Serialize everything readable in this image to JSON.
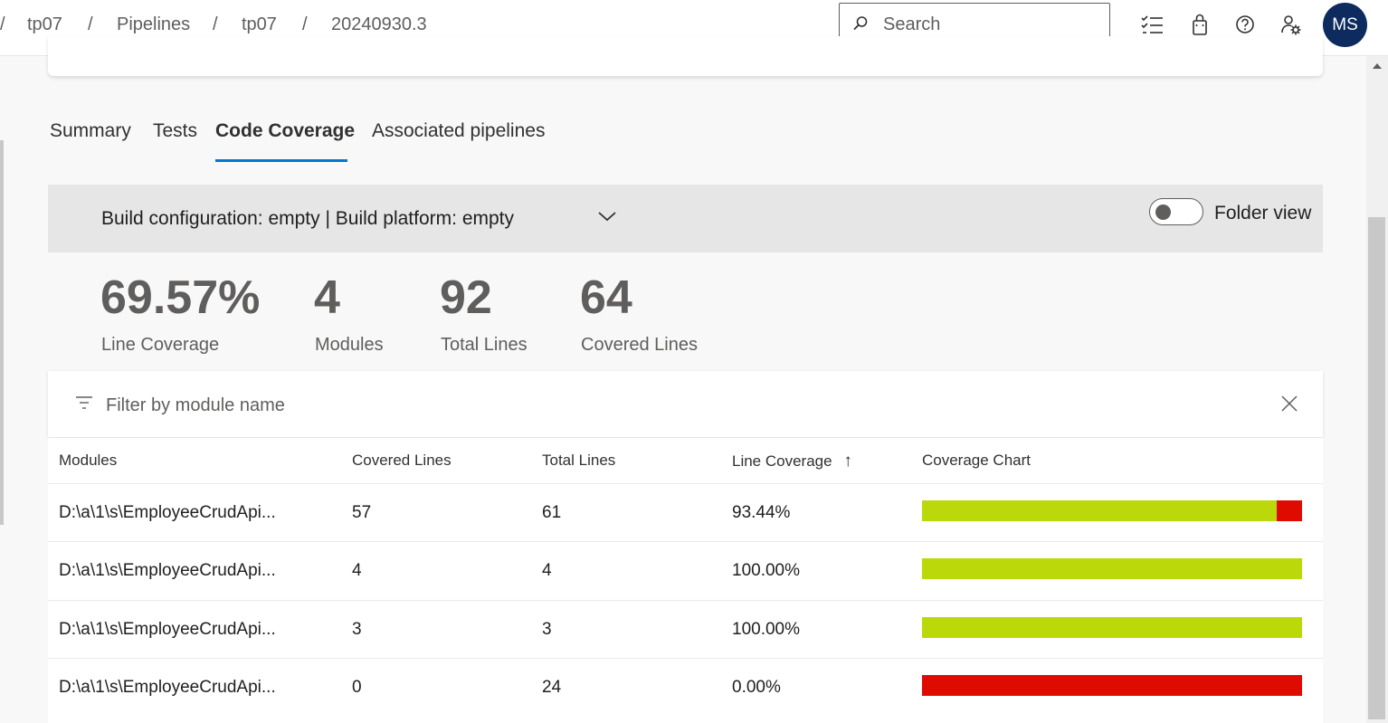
{
  "breadcrumb": {
    "items": [
      "tp07",
      "Pipelines",
      "tp07",
      "20240930.3"
    ],
    "separator": "/"
  },
  "search": {
    "placeholder": "Search"
  },
  "user": {
    "initials": "MS"
  },
  "tabs": [
    {
      "label": "Summary",
      "active": false
    },
    {
      "label": "Tests",
      "active": false
    },
    {
      "label": "Code Coverage",
      "active": true
    },
    {
      "label": "Associated pipelines",
      "active": false
    }
  ],
  "config": {
    "label": "Build configuration: empty | Build platform: empty",
    "folder_view_label": "Folder view",
    "folder_view_on": false
  },
  "stats": [
    {
      "value": "69.57%",
      "label": "Line Coverage"
    },
    {
      "value": "4",
      "label": "Modules"
    },
    {
      "value": "92",
      "label": "Total Lines"
    },
    {
      "value": "64",
      "label": "Covered Lines"
    }
  ],
  "filter": {
    "placeholder": "Filter by module name"
  },
  "table": {
    "headers": [
      "Modules",
      "Covered Lines",
      "Total Lines",
      "Line Coverage",
      "Coverage Chart"
    ],
    "sort_indicator": "↑",
    "rows": [
      {
        "module": "D:\\a\\1\\s\\EmployeeCrudApi...",
        "covered": "57",
        "total": "61",
        "coverage": "93.44%",
        "fraction": 0.9344
      },
      {
        "module": "D:\\a\\1\\s\\EmployeeCrudApi...",
        "covered": "4",
        "total": "4",
        "coverage": "100.00%",
        "fraction": 1.0
      },
      {
        "module": "D:\\a\\1\\s\\EmployeeCrudApi...",
        "covered": "3",
        "total": "3",
        "coverage": "100.00%",
        "fraction": 1.0
      },
      {
        "module": "D:\\a\\1\\s\\EmployeeCrudApi...",
        "covered": "0",
        "total": "24",
        "coverage": "0.00%",
        "fraction": 0.0
      }
    ]
  },
  "colors": {
    "covered": "#bad80a",
    "uncovered": "#e00b00",
    "accent": "#0078d4",
    "avatar": "#0d2b5e"
  }
}
